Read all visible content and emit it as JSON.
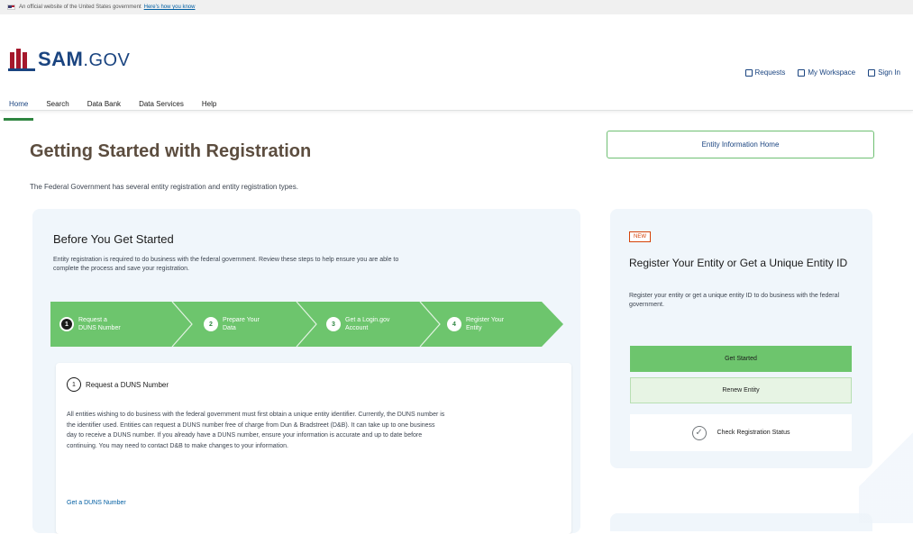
{
  "banner": {
    "text": "An official website of the United States government",
    "link": "Here's how you know"
  },
  "logo": {
    "name": "SAM",
    "suffix": ".GOV"
  },
  "utility_nav": [
    {
      "label": "Requests",
      "icon": "inbox-icon"
    },
    {
      "label": "My Workspace",
      "icon": "grid-icon"
    },
    {
      "label": "Sign In",
      "icon": "user-icon"
    }
  ],
  "main_nav": [
    {
      "label": "Home",
      "active": true
    },
    {
      "label": "Search"
    },
    {
      "label": "Data Bank"
    },
    {
      "label": "Data Services"
    },
    {
      "label": "Help"
    }
  ],
  "page": {
    "title": "Getting Started with Registration",
    "description": "The Federal Government has several entity registration and entity registration types."
  },
  "entity_button": "Entity Information Home",
  "before_card": {
    "title": "Before You Get Started",
    "intro": "Entity registration is required to do business with the federal government. Review these steps to help ensure you are able to complete the process and save your registration."
  },
  "steps": [
    {
      "num": "1",
      "label": "Request a\nDUNS Number",
      "active": true
    },
    {
      "num": "2",
      "label": "Prepare Your\nData"
    },
    {
      "num": "3",
      "label": "Get a Login.gov\nAccount"
    },
    {
      "num": "4",
      "label": "Register Your\nEntity"
    }
  ],
  "step_detail": {
    "heading": "Request a DUNS Number",
    "body": "All entities wishing to do business with the federal government must first obtain a unique entity identifier. Currently, the DUNS number is the identifier used. Entities can request a DUNS number free of charge from Dun & Bradstreet (D&B). It can take up to one business day to receive a DUNS number. If you already have a DUNS number, ensure your information is accurate and up to date before continuing. You may need to contact D&B to make changes to your information.",
    "link": "Get a DUNS Number"
  },
  "side_card": {
    "badge": "NEW",
    "title": "Register Your Entity or Get a Unique Entity ID",
    "description": "Register your entity or get a unique entity ID to do business with the federal government.",
    "primary": "Get Started",
    "secondary": "Renew Entity",
    "check": "Check Registration Status"
  },
  "colors": {
    "brand_blue": "#1a4480",
    "accent_green": "#6dc56d",
    "title_brown": "#5c4d3f",
    "card_bg": "#f0f6fb"
  }
}
